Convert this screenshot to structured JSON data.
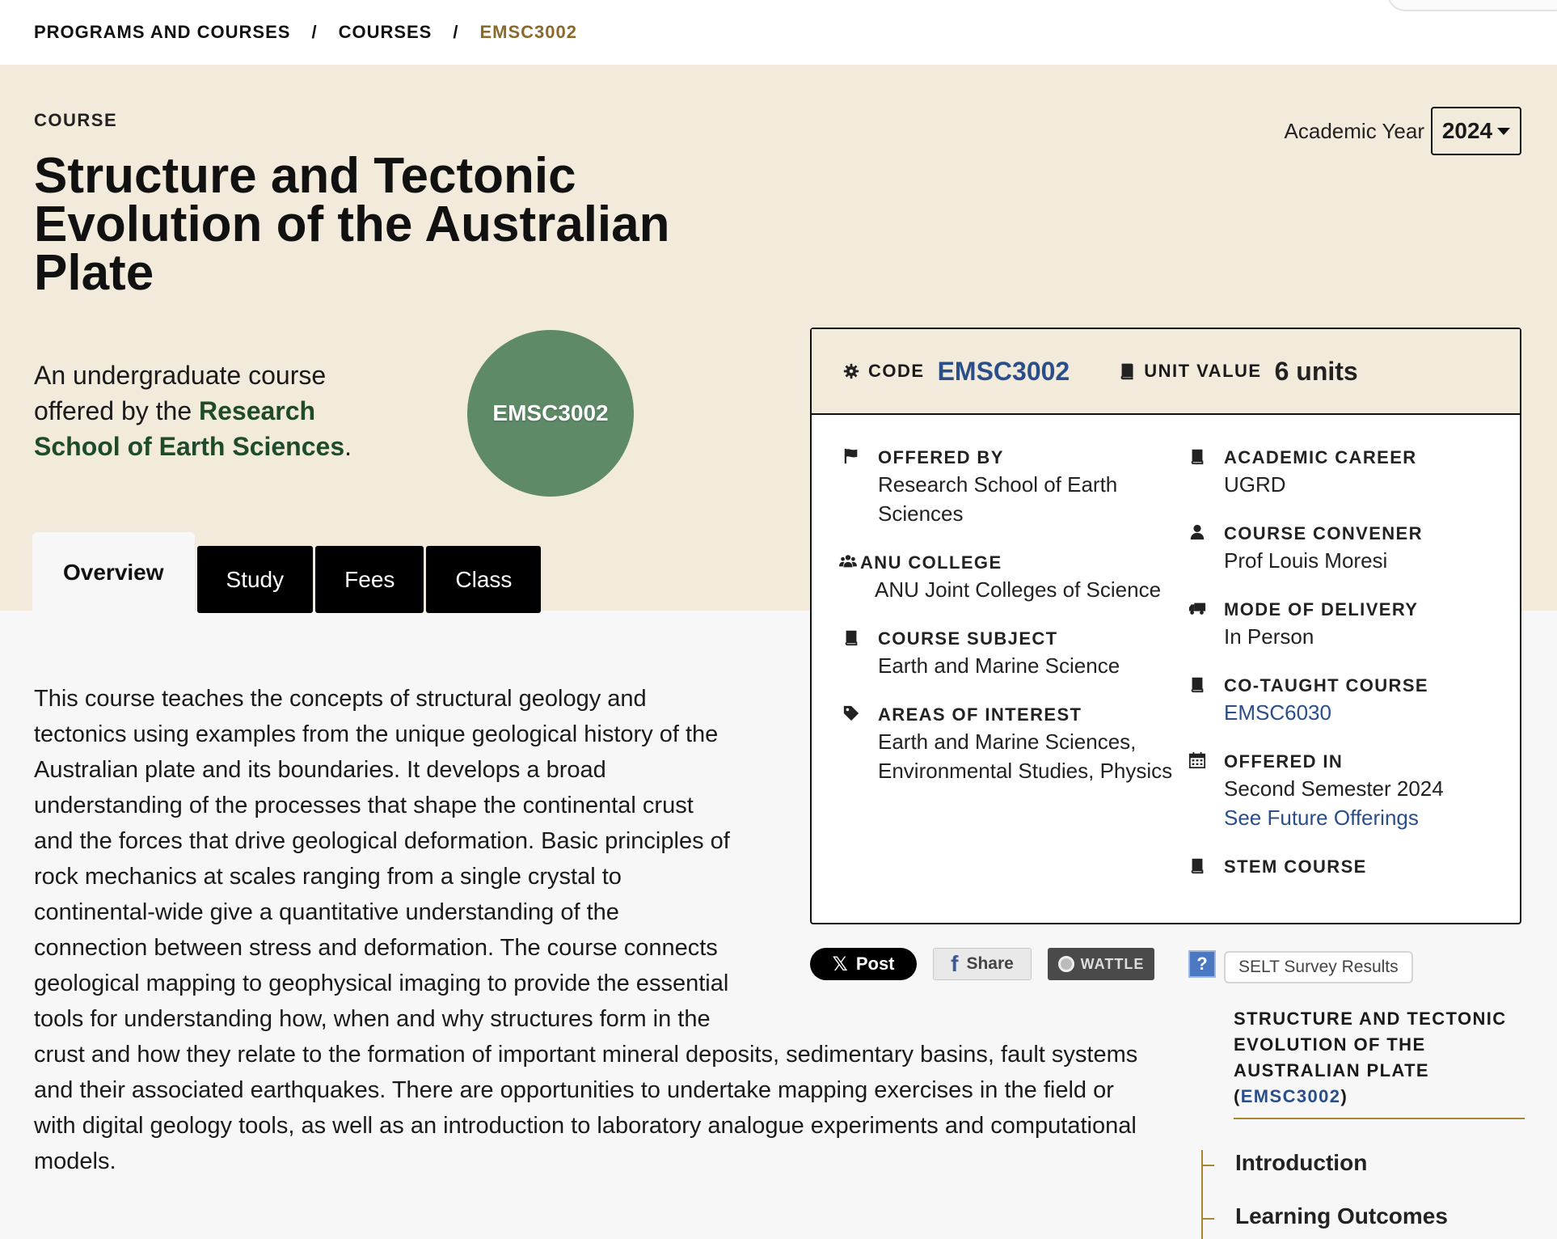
{
  "breadcrumb": {
    "items": [
      "PROGRAMS AND COURSES",
      "COURSES"
    ],
    "separator": "/",
    "current": "EMSC3002"
  },
  "hero": {
    "type_label": "COURSE",
    "title": "Structure and Tectonic Evolution of the Australian Plate",
    "intro_prefix": "An undergraduate course offered by the ",
    "intro_link": "Research School of Earth Sciences",
    "intro_suffix": ".",
    "circle_code": "EMSC3002",
    "academic_year_label": "Academic Year",
    "academic_year_value": "2024"
  },
  "tabs": [
    {
      "label": "Overview",
      "active": true
    },
    {
      "label": "Study",
      "active": false
    },
    {
      "label": "Fees",
      "active": false
    },
    {
      "label": "Class",
      "active": false
    }
  ],
  "info_card": {
    "code_label": "CODE",
    "code_value": "EMSC3002",
    "unit_label": "UNIT VALUE",
    "unit_value": "6 units",
    "offered_by_label": "OFFERED BY",
    "offered_by_value": "Research School of Earth Sciences",
    "college_label": "ANU COLLEGE",
    "college_value": "ANU Joint Colleges of Science",
    "subject_label": "COURSE SUBJECT",
    "subject_value": "Earth and Marine Science",
    "interest_label": "AREAS OF INTEREST",
    "interest_value": "Earth and Marine Sciences, Environmental Studies, Physics",
    "career_label": "ACADEMIC CAREER",
    "career_value": "UGRD",
    "convener_label": "COURSE CONVENER",
    "convener_value": "Prof Louis Moresi",
    "delivery_label": "MODE OF DELIVERY",
    "delivery_value": "In Person",
    "cotaught_label": "CO-TAUGHT COURSE",
    "cotaught_value": "EMSC6030",
    "offered_in_label": "OFFERED IN",
    "offered_in_value": "Second Semester 2024",
    "future_link": "See Future Offerings",
    "stem_label": "STEM COURSE",
    "icons": {
      "code": "gear-icon",
      "unit": "book-icon",
      "offered_by": "flag-icon",
      "college": "users-icon",
      "subject": "book-icon",
      "interest": "tag-icon",
      "career": "book-icon",
      "convener": "user-icon",
      "delivery": "truck-icon",
      "cotaught": "book-icon",
      "offered_in": "calendar-icon",
      "stem": "book-icon"
    }
  },
  "social": {
    "x_label": "Post",
    "share_label": "Share",
    "wattle_label": "WATTLE",
    "help_label": "?",
    "selt_label": "SELT Survey Results"
  },
  "description": "This course teaches the concepts of structural geology and tectonics using examples from the unique geological history of the Australian plate and its boundaries. It develops a broad understanding of the processes that shape the continental crust and the forces that drive geological deformation. Basic principles of rock mechanics at scales ranging from a single crystal to continental-wide give a quantitative understanding of the connection between stress and deformation. The course connects geological mapping to geophysical imaging to provide the essential tools for understanding how, when and why structures form in the crust and how they relate to the formation of important mineral deposits, sedimentary basins, fault systems and their associated earthquakes. There are opportunities to undertake mapping exercises in the field or with digital geology tools, as well as an introduction to laboratory analogue experiments and computational models.",
  "toc": {
    "title_text": "STRUCTURE AND TECTONIC EVOLUTION OF THE AUSTRALIAN PLATE",
    "title_code": "EMSC3002",
    "items": [
      "Introduction",
      "Learning Outcomes"
    ]
  },
  "colors": {
    "hero_bg": "#f2eadb",
    "accent_gold": "#8a6a2a",
    "circle_green": "#5e8a68",
    "link_blue": "#2a4e8a",
    "intro_link_green": "#1f4a2c"
  }
}
